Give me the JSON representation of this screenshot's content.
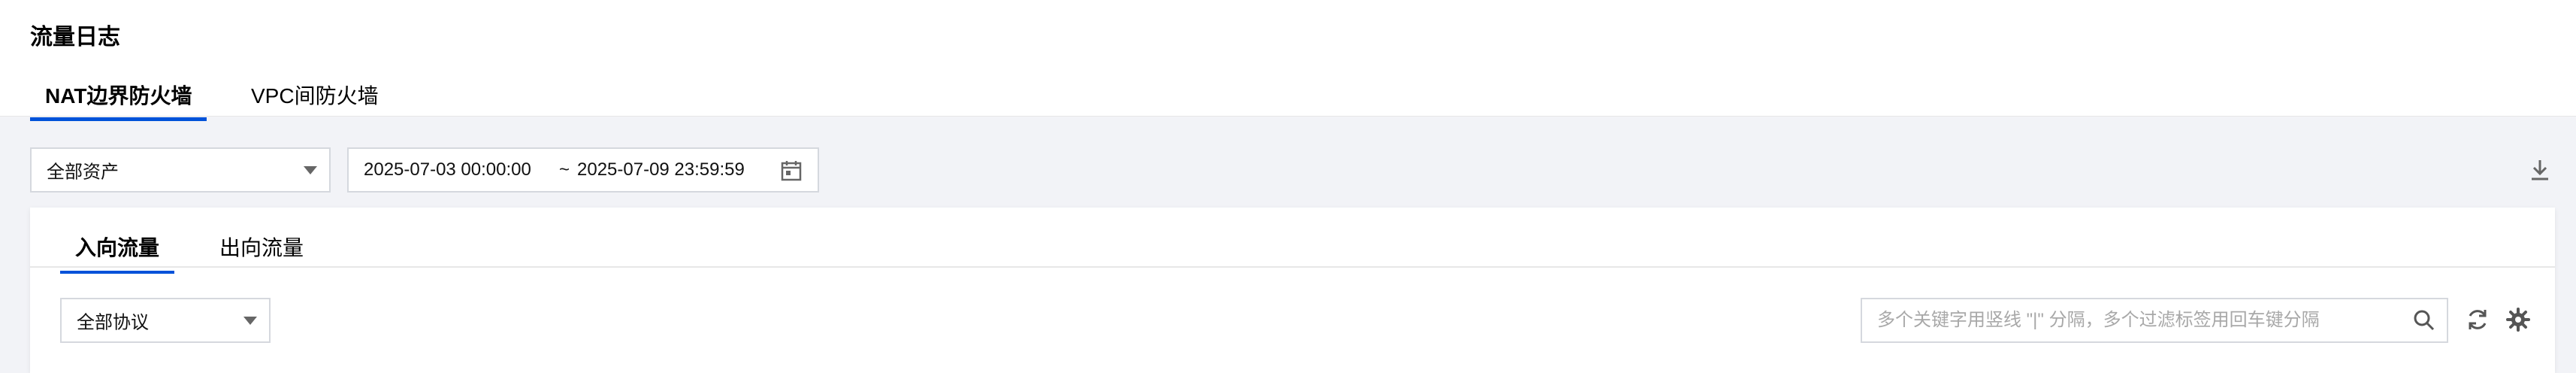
{
  "page": {
    "title": "流量日志"
  },
  "top_tabs": [
    {
      "label": "NAT边界防火墙",
      "active": true
    },
    {
      "label": "VPC间防火墙",
      "active": false
    }
  ],
  "filters": {
    "asset_select": "全部资产",
    "date_start": "2025-07-03 00:00:00",
    "date_separator": "~",
    "date_end": "2025-07-09 23:59:59"
  },
  "traffic_tabs": [
    {
      "label": "入向流量",
      "active": true
    },
    {
      "label": "出向流量",
      "active": false
    }
  ],
  "table_tools": {
    "protocol_select": "全部协议",
    "search_placeholder": "多个关键字用竖线 \"|\" 分隔，多个过滤标签用回车键分隔"
  },
  "icons": [
    "calendar-icon",
    "download-icon",
    "search-icon",
    "refresh-icon",
    "gear-icon"
  ],
  "colors": {
    "accent": "#0052d9",
    "page_bg": "#f2f3f7"
  }
}
